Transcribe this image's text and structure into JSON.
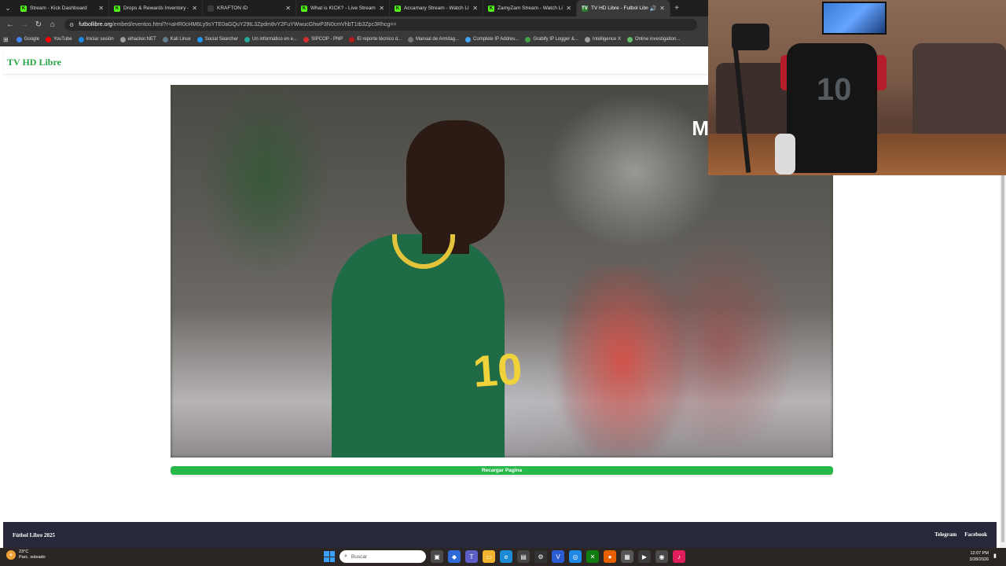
{
  "browser": {
    "tabs": [
      {
        "label": "Stream - Kick Dashboard",
        "favicon": "K",
        "active": false
      },
      {
        "label": "Drops & Rewards Inventory - K",
        "favicon": "K",
        "active": false
      },
      {
        "label": "KRAFTON ID",
        "favicon": "",
        "active": false
      },
      {
        "label": "What is KICK? - Live Stream &",
        "favicon": "K",
        "active": false
      },
      {
        "label": "Accamary Stream - Watch Live",
        "favicon": "K",
        "active": false
      },
      {
        "label": "ZamyZam Stream - Watch Live",
        "favicon": "K",
        "active": false
      },
      {
        "label": "TV HD Libre - Futbol Libre",
        "favicon": "TV",
        "active": true
      }
    ],
    "address": {
      "host": "futbollibre.org",
      "path": "/embed/eventos.html?r=aHR0cHM6Ly9sYTE0aGQuY29tL3Zpdm8vY2FuYWwucGhwP3N0cmVhbT1tb3Zpc3Rhcg=="
    },
    "bookmarks": [
      {
        "label": "Google",
        "color": "#4285f4"
      },
      {
        "label": "YouTube",
        "color": "#ff0000"
      },
      {
        "label": "Iniciar sesión",
        "color": "#1e88e5"
      },
      {
        "label": "elhacker.NET",
        "color": "#9e9e9e"
      },
      {
        "label": "Kali Linux",
        "color": "#607d8b"
      },
      {
        "label": "Social Searcher",
        "color": "#2196f3"
      },
      {
        "label": "Un informático en e...",
        "color": "#26a69a"
      },
      {
        "label": "SIPCOP - PNP",
        "color": "#d32f2f"
      },
      {
        "label": "El reporte técnico d...",
        "color": "#b71c1c"
      },
      {
        "label": "Manual de Armitag...",
        "color": "#757575"
      },
      {
        "label": "Complete IP Addres...",
        "color": "#42a5f5"
      },
      {
        "label": "Grabify IP Logger &...",
        "color": "#43a047"
      },
      {
        "label": "Intelligence X",
        "color": "#9e9e9e"
      },
      {
        "label": "Online investigation...",
        "color": "#66bb6a"
      }
    ]
  },
  "site": {
    "title": "TV HD Libre",
    "accent": "#28a745",
    "video": {
      "broadcaster_logo": "M",
      "jersey_number": "10"
    },
    "reload_label": "Recargar Pagina",
    "footer": {
      "brand": "Fútbol Libre 2025",
      "links": [
        "Telegram",
        "Facebook"
      ]
    }
  },
  "webcam": {
    "shirt_number": "10"
  },
  "taskbar": {
    "weather": {
      "temp": "23°C",
      "condition": "Parc. soleado"
    },
    "search_placeholder": "Buscar",
    "time": "12:07 PM",
    "date": "3/28/2026"
  }
}
